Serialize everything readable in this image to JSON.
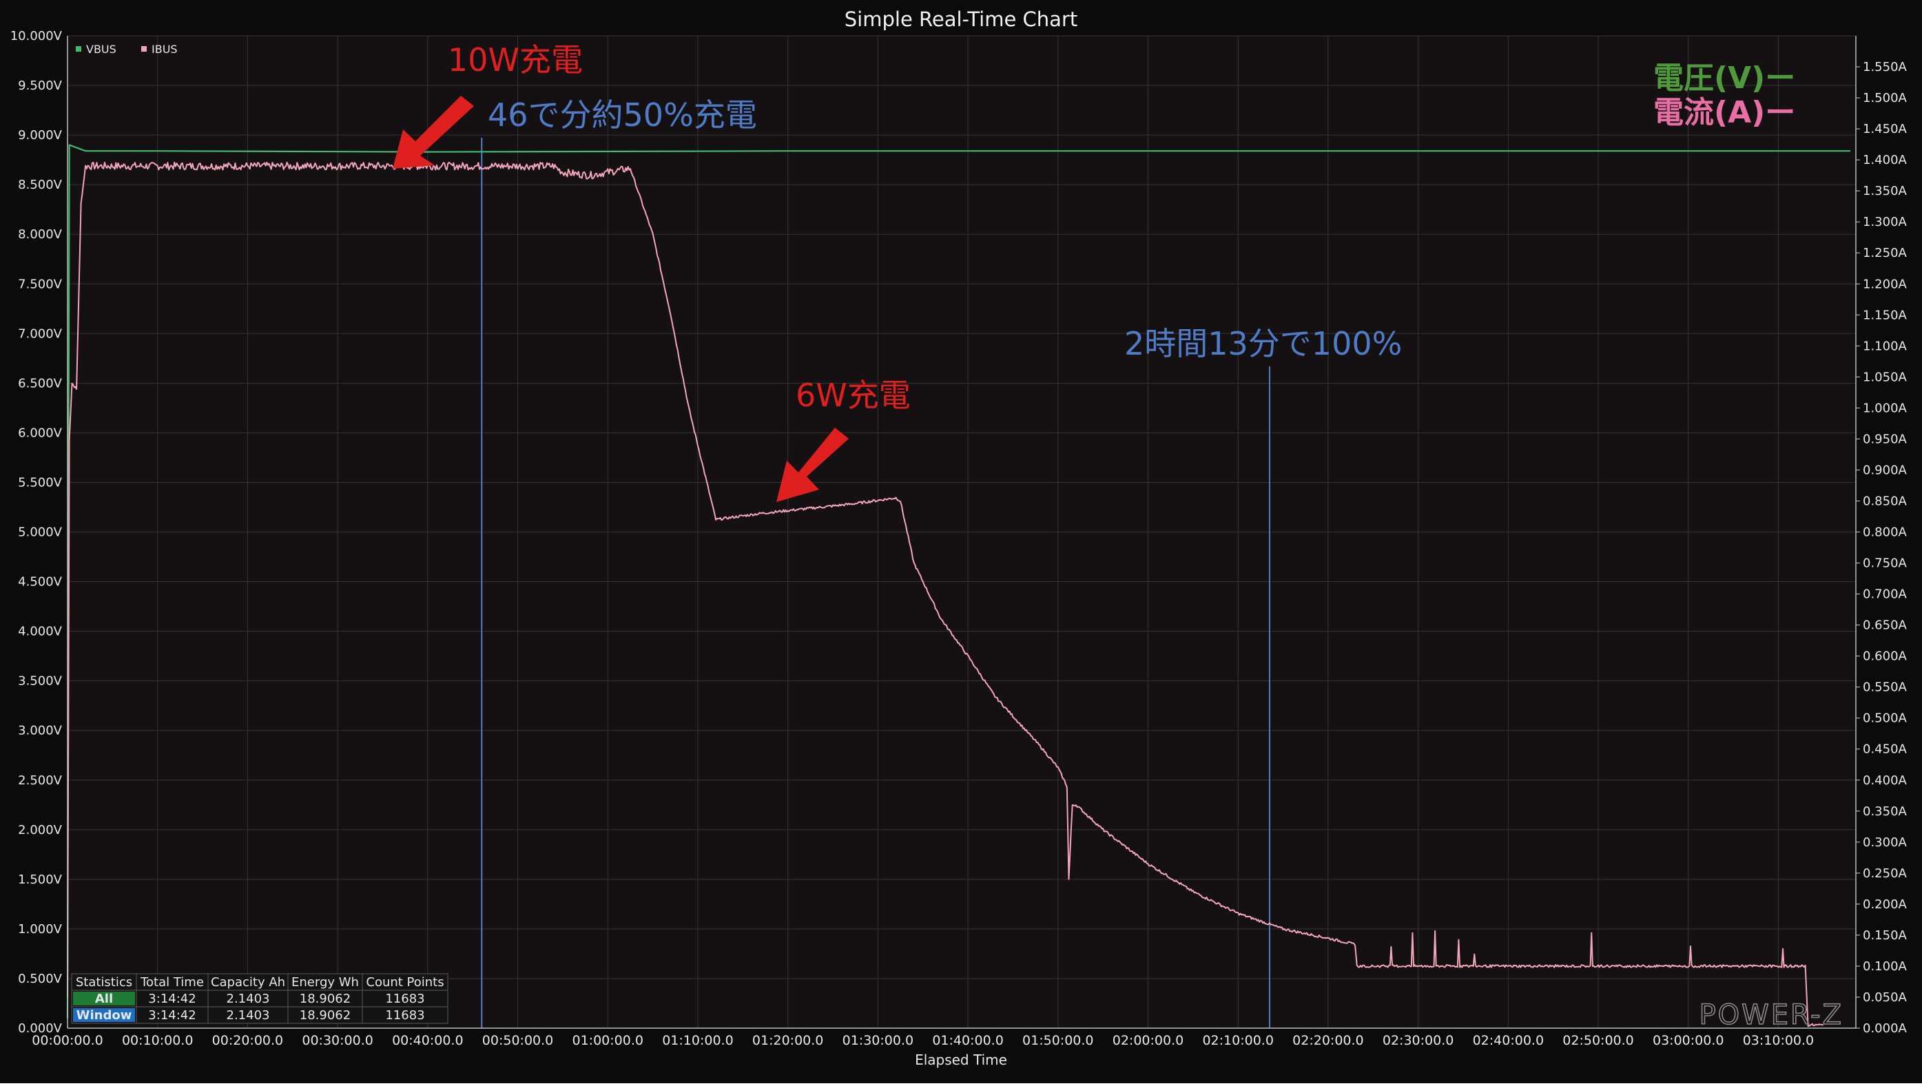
{
  "chart_data": {
    "type": "line",
    "title": "Simple Real-Time Chart",
    "xlabel": "Elapsed Time",
    "ylabel_left": "",
    "ylabel_right": "",
    "x_unit": "minutes",
    "xlim": [
      0,
      198
    ],
    "ylim_left": [
      0,
      10
    ],
    "ylim_right": [
      0,
      1.6
    ],
    "x_ticks": [
      "00:00:00.0",
      "00:10:00.0",
      "00:20:00.0",
      "00:30:00.0",
      "00:40:00.0",
      "00:50:00.0",
      "01:00:00.0",
      "01:10:00.0",
      "01:20:00.0",
      "01:30:00.0",
      "01:40:00.0",
      "01:50:00.0",
      "02:00:00.0",
      "02:10:00.0",
      "02:20:00.0",
      "02:30:00.0",
      "02:40:00.0",
      "02:50:00.0",
      "03:00:00.0",
      "03:10:00.0"
    ],
    "y_ticks_left": [
      "0.000V",
      "0.500V",
      "1.000V",
      "1.500V",
      "2.000V",
      "2.500V",
      "3.000V",
      "3.500V",
      "4.000V",
      "4.500V",
      "5.000V",
      "5.500V",
      "6.000V",
      "6.500V",
      "7.000V",
      "7.500V",
      "8.000V",
      "8.500V",
      "9.000V",
      "9.500V",
      "10.000V"
    ],
    "y_ticks_right": [
      "0.000A",
      "0.050A",
      "0.100A",
      "0.150A",
      "0.200A",
      "0.250A",
      "0.300A",
      "0.350A",
      "0.400A",
      "0.450A",
      "0.500A",
      "0.550A",
      "0.600A",
      "0.650A",
      "0.700A",
      "0.750A",
      "0.800A",
      "0.850A",
      "0.900A",
      "0.950A",
      "1.000A",
      "1.050A",
      "1.100A",
      "1.150A",
      "1.200A",
      "1.250A",
      "1.300A",
      "1.350A",
      "1.400A",
      "1.450A",
      "1.500A",
      "1.550A"
    ],
    "grid": true,
    "legend_position": "top-left",
    "background": "#151012",
    "series": [
      {
        "name": "VBUS",
        "axis": "left",
        "unit": "V",
        "color": "#3dbb6e",
        "x": [
          0,
          0.1,
          0.2,
          2,
          10,
          40,
          80,
          120,
          160,
          198
        ],
        "values": [
          0.1,
          5.0,
          8.9,
          8.84,
          8.84,
          8.83,
          8.84,
          8.84,
          8.84,
          8.84
        ]
      },
      {
        "name": "IBUS",
        "axis": "left-scaled",
        "unit": "A",
        "color": "#f2a5bc",
        "x": [
          0,
          0.2,
          0.5,
          1.0,
          1.5,
          2.0,
          10,
          20,
          30,
          40,
          50,
          54,
          55,
          58,
          62,
          62.5,
          65,
          67,
          69,
          72,
          77,
          87,
          92,
          92.5,
          94,
          97,
          100,
          103,
          108,
          110,
          111,
          111.2,
          111.6,
          112,
          115,
          120,
          125,
          130,
          135,
          140,
          143,
          143.2,
          144,
          150,
          160,
          170,
          180,
          190,
          193,
          193.3,
          194.5,
          195
        ],
        "values": [
          0.05,
          0.95,
          1.04,
          1.03,
          1.33,
          1.39,
          1.39,
          1.39,
          1.39,
          1.39,
          1.39,
          1.39,
          1.38,
          1.375,
          1.385,
          1.386,
          1.28,
          1.15,
          1.0,
          0.82,
          0.83,
          0.845,
          0.855,
          0.85,
          0.75,
          0.66,
          0.6,
          0.535,
          0.455,
          0.42,
          0.39,
          0.24,
          0.36,
          0.36,
          0.32,
          0.265,
          0.22,
          0.185,
          0.16,
          0.145,
          0.135,
          0.1,
          0.1,
          0.1,
          0.1,
          0.1,
          0.1,
          0.1,
          0.1,
          0.005,
          0.005,
          0.005
        ]
      }
    ],
    "vertical_markers_minutes": [
      46,
      133.5
    ],
    "annotations": [
      {
        "text": "10W充電",
        "color": "#e0201e"
      },
      {
        "text": "46で分約50%充電",
        "color": "#4f7cc7"
      },
      {
        "text": "6W充電",
        "color": "#e0201e"
      },
      {
        "text": "2時間13分で100%",
        "color": "#4f7cc7"
      },
      {
        "text": "電圧(V)ー",
        "color": "#4e9a3c"
      },
      {
        "text": "電流(A)ー",
        "color": "#e86fa3"
      }
    ],
    "legend": [
      {
        "label": "VBUS",
        "color": "#3dbb6e"
      },
      {
        "label": "IBUS",
        "color": "#f2a5bc"
      }
    ],
    "watermark": "POWER-Z",
    "statistics": {
      "headers": [
        "Statistics",
        "Total Time",
        "Capacity Ah",
        "Energy Wh",
        "Count Points"
      ],
      "rows": [
        {
          "label": "All",
          "label_color": "#1f7a35",
          "values": [
            "3:14:42",
            "2.1403",
            "18.9062",
            "11683"
          ]
        },
        {
          "label": "Window",
          "label_color": "#1e6fc2",
          "values": [
            "3:14:42",
            "2.1403",
            "18.9062",
            "11683"
          ]
        }
      ]
    }
  }
}
